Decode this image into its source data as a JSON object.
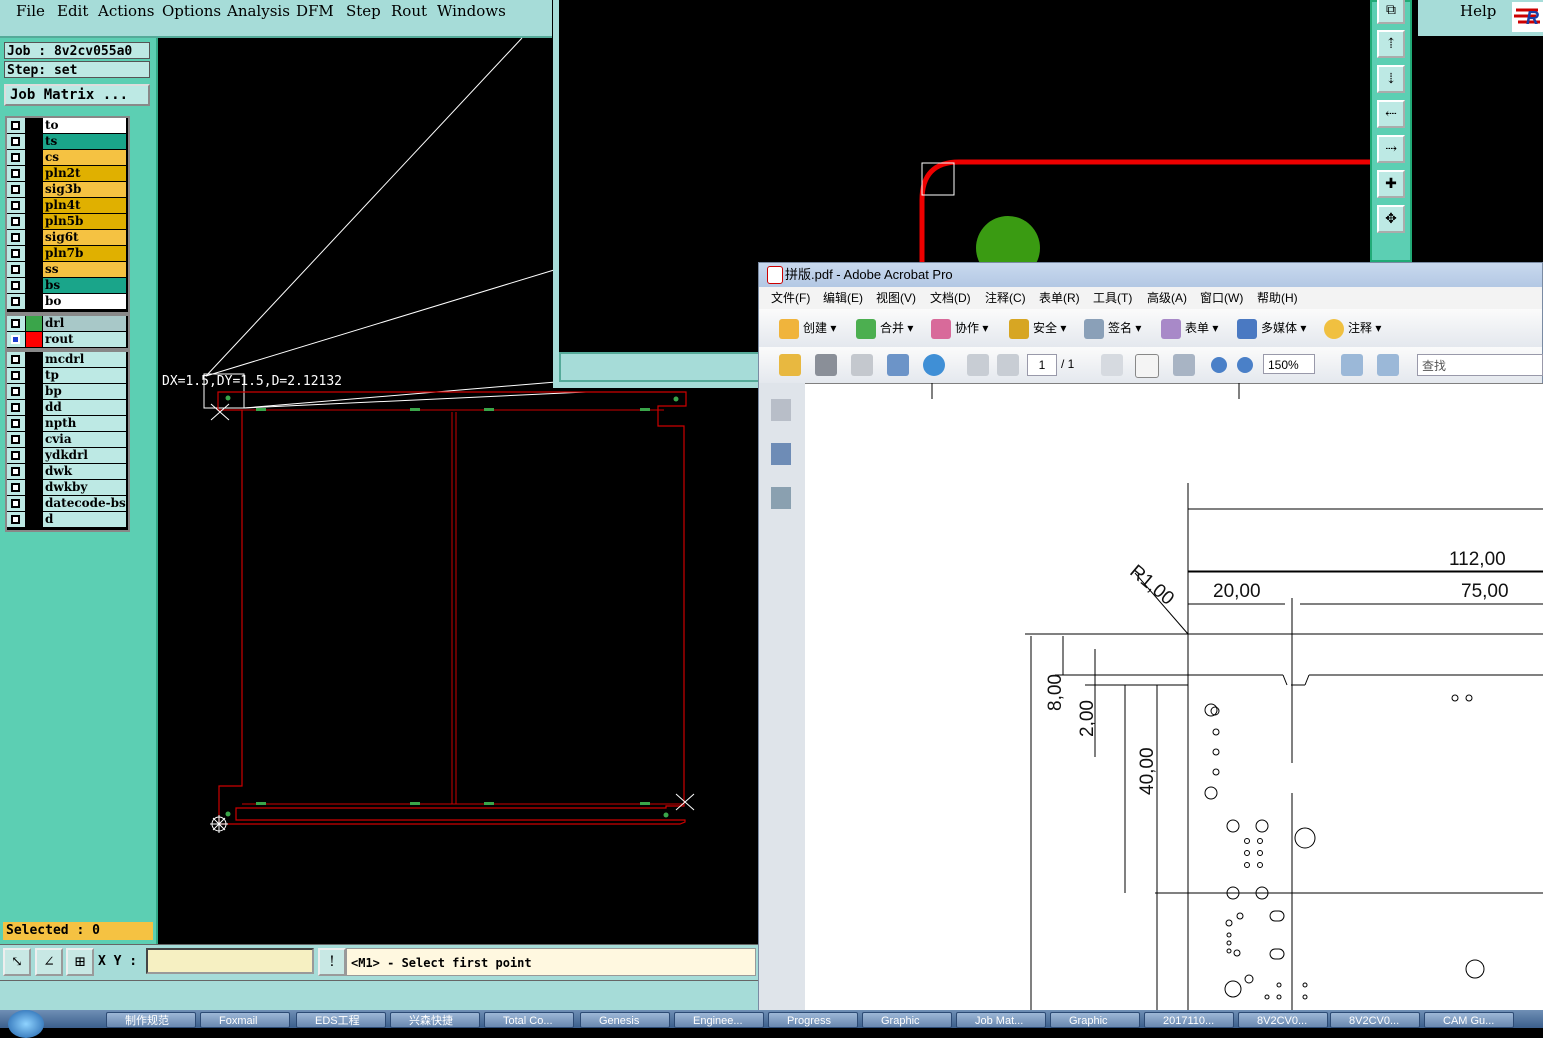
{
  "menubar": {
    "items": [
      "File",
      "Edit",
      "Actions",
      "Options",
      "Analysis",
      "DFM",
      "Step",
      "Rout",
      "Windows"
    ],
    "help": "Help"
  },
  "job": {
    "label": "Job : 8v2cv055a0",
    "step": "Step: set",
    "matrix_button": "Job Matrix ..."
  },
  "layers_board": [
    {
      "name": "to",
      "color": "#ffffff"
    },
    {
      "name": "ts",
      "color": "#1aa58a"
    },
    {
      "name": "cs",
      "color": "#f5c242"
    },
    {
      "name": "pln2t",
      "color": "#e0b000"
    },
    {
      "name": "sig3b",
      "color": "#f5c242"
    },
    {
      "name": "pln4t",
      "color": "#e0b000"
    },
    {
      "name": "pln5b",
      "color": "#e0b000"
    },
    {
      "name": "sig6t",
      "color": "#f5c242"
    },
    {
      "name": "pln7b",
      "color": "#e0b000"
    },
    {
      "name": "ss",
      "color": "#f5c242"
    },
    {
      "name": "bs",
      "color": "#1aa58a"
    },
    {
      "name": "bo",
      "color": "#ffffff"
    }
  ],
  "layers_drill": [
    {
      "name": "drl",
      "color": "#a8c8c8",
      "swatch": "#3aa54a"
    },
    {
      "name": "rout",
      "color": "#bde9e4",
      "swatch": "#ff0000",
      "active": true
    }
  ],
  "layers_misc": [
    "mcdrl",
    "tp",
    "bp",
    "dd",
    "npth",
    "cvia",
    "ydkdrl",
    "dwk",
    "dwkby",
    "datecode-bs",
    "d"
  ],
  "selected": "Selected : 0",
  "measurement": "DX=1.5,DY=1.5,D=2.12132",
  "coords": {
    "label": "X Y :",
    "value": ""
  },
  "prompt": "<M1> - Select first point",
  "acrobat": {
    "title": "拼版.pdf - Adobe Acrobat Pro",
    "menu": [
      "文件(F)",
      "编辑(E)",
      "视图(V)",
      "文档(D)",
      "注释(C)",
      "表单(R)",
      "工具(T)",
      "高级(A)",
      "窗口(W)",
      "帮助(H)"
    ],
    "toolbar": [
      "创建",
      "合并",
      "协作",
      "安全",
      "签名",
      "表单",
      "多媒体",
      "注释"
    ],
    "page_current": "1",
    "page_total": "/ 1",
    "zoom": "150%",
    "search_placeholder": "查找",
    "dimensions": [
      "112,00",
      "20,00",
      "75,00",
      "R1,00",
      "8,00",
      "2,00",
      "40,00"
    ]
  },
  "taskbar": [
    "制作规范",
    "Foxmail",
    "EDS工程",
    "兴森快捷",
    "Total Co...",
    "Genesis",
    "Enginee...",
    "Progress",
    "Graphic",
    "Job Mat...",
    "Graphic",
    "2017110...",
    "8V2CV0...",
    "8V2CV0...",
    "CAM Gu..."
  ]
}
